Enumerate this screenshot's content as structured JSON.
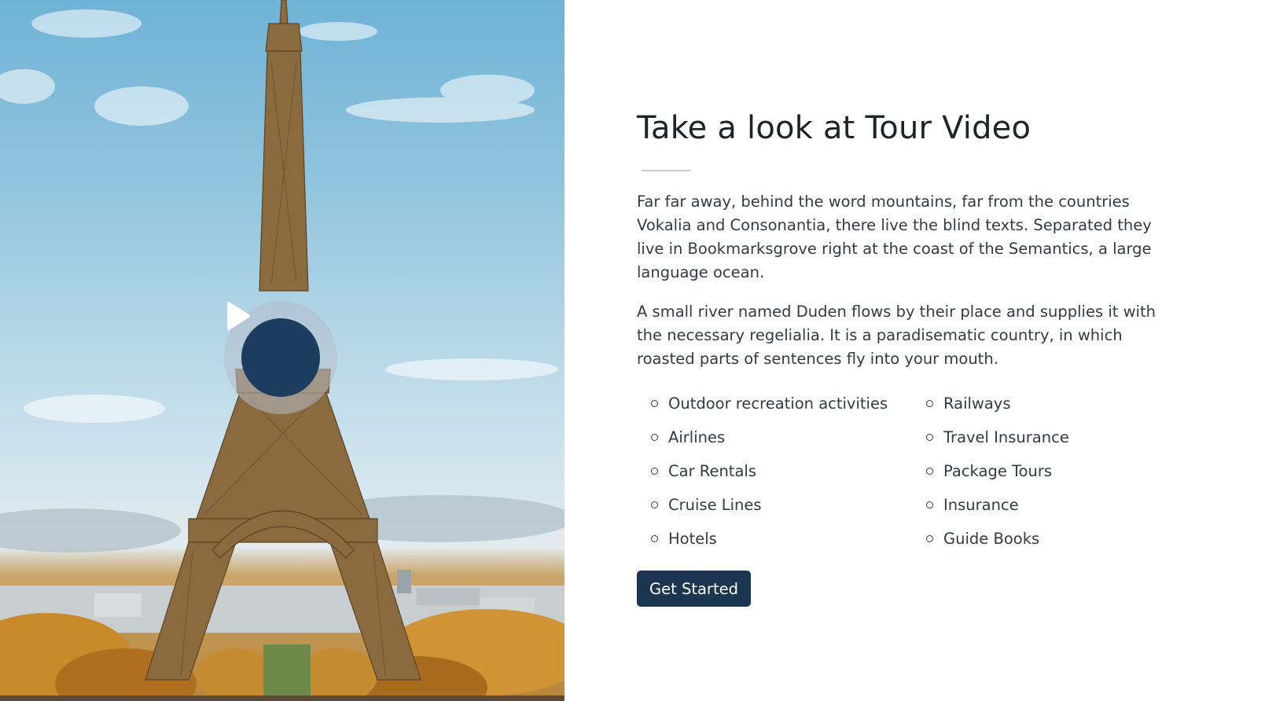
{
  "video_section": {
    "background_image": "eiffel-tower-photo",
    "play_icon": "play-icon"
  },
  "content": {
    "title": "Take a look at Tour Video",
    "paragraphs": [
      "Far far away, behind the word mountains, far from the countries Vokalia and Consonantia, there live the blind texts. Separated they live in Bookmarksgrove right at the coast of the Semantics, a large language ocean.",
      "A small river named Duden flows by their place and supplies it with the necessary regelialia. It is a paradisematic country, in which roasted parts of sentences fly into your mouth."
    ],
    "list_left": [
      "Outdoor recreation activities",
      "Airlines",
      "Car Rentals",
      "Cruise Lines",
      "Hotels"
    ],
    "list_right": [
      "Railways",
      "Travel Insurance",
      "Package Tours",
      "Insurance",
      "Guide Books"
    ],
    "cta_label": "Get Started"
  },
  "colors": {
    "primary": "#1c3550",
    "text": "#212529"
  }
}
